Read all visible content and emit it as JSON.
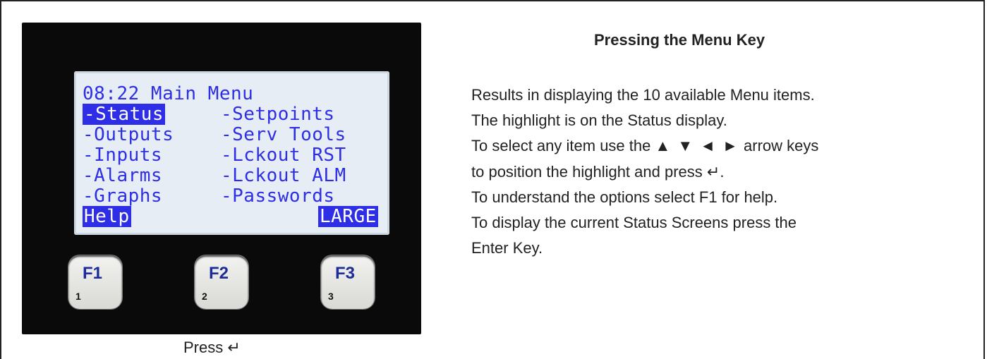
{
  "lcd": {
    "header": "08:22 Main Menu",
    "items_left": [
      "-Status",
      "-Outputs",
      "-Inputs",
      "-Alarms",
      "-Graphs"
    ],
    "items_right": [
      "-Setpoints",
      "-Serv Tools",
      "-Lckout RST",
      "-Lckout ALM",
      "-Passwords"
    ],
    "soft_left": "Help",
    "soft_right": "LARGE",
    "highlighted_item": "-Status",
    "text_color": "#2e2ee6",
    "background_color": "#e6edf4"
  },
  "keys": [
    {
      "label": "F1",
      "number": "1"
    },
    {
      "label": "F2",
      "number": "2"
    },
    {
      "label": "F3",
      "number": "3"
    }
  ],
  "caption": "Press ↵",
  "heading": "Pressing the Menu Key",
  "lines": {
    "l1": "Results in displaying the 10 available Menu items.",
    "l2": "The highlight is on the Status display.",
    "l3a": "To select any item use the",
    "l3arrows": "▲ ▼ ◄ ►",
    "l3b": "arrow keys",
    "l4": "to position the highlight and press ↵.",
    "l5": "To understand the options select F1 for help.",
    "l6": "To display the current Status Screens press the",
    "l7": "Enter Key."
  }
}
